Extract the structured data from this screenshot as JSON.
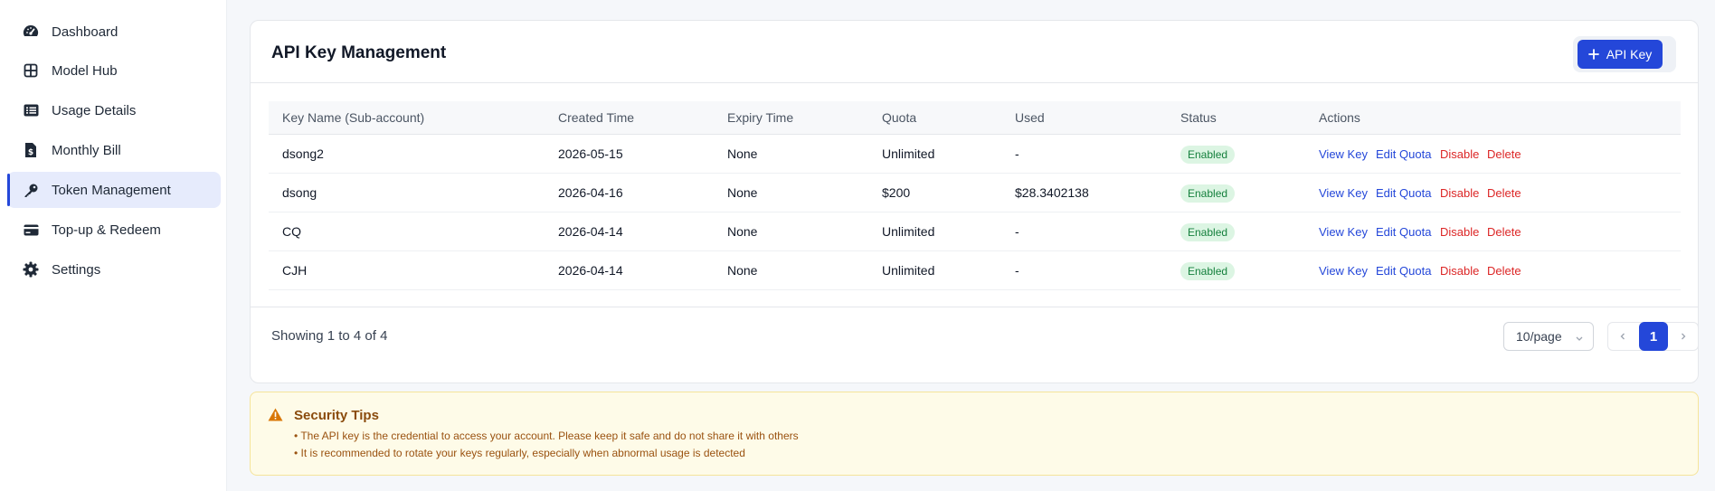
{
  "sidebar": {
    "items": [
      {
        "label": "Dashboard",
        "icon": "gauge-icon"
      },
      {
        "label": "Model Hub",
        "icon": "grid-icon"
      },
      {
        "label": "Usage Details",
        "icon": "list-icon"
      },
      {
        "label": "Monthly Bill",
        "icon": "receipt-icon"
      },
      {
        "label": "Token Management",
        "icon": "key-icon",
        "active": true
      },
      {
        "label": "Top-up & Redeem",
        "icon": "credit-card-icon"
      },
      {
        "label": "Settings",
        "icon": "gear-icon"
      }
    ]
  },
  "card": {
    "title": "API Key Management",
    "add_button_label": "API Key"
  },
  "table": {
    "headers": [
      "Key Name (Sub-account)",
      "Created Time",
      "Expiry Time",
      "Quota",
      "Used",
      "Status",
      "Actions"
    ],
    "rows": [
      {
        "name": "dsong2",
        "created": "2026-05-15",
        "expiry": "None",
        "quota": "Unlimited",
        "used": "-",
        "status": "Enabled"
      },
      {
        "name": "dsong",
        "created": "2026-04-16",
        "expiry": "None",
        "quota": "$200",
        "used": "$28.3402138",
        "status": "Enabled"
      },
      {
        "name": "CQ",
        "created": "2026-04-14",
        "expiry": "None",
        "quota": "Unlimited",
        "used": "-",
        "status": "Enabled"
      },
      {
        "name": "CJH",
        "created": "2026-04-14",
        "expiry": "None",
        "quota": "Unlimited",
        "used": "-",
        "status": "Enabled"
      }
    ],
    "actions": {
      "view": "View Key",
      "edit": "Edit Quota",
      "disable": "Disable",
      "delete": "Delete"
    }
  },
  "footer": {
    "showing": "Showing 1 to 4 of 4",
    "page_size": "10/page",
    "current_page": "1"
  },
  "tips": {
    "title": "Security Tips",
    "lines": [
      "• The API key is the credential to access your account. Please keep it safe and do not share it with others",
      "• It is recommended to rotate your keys regularly, especially when abnormal usage is detected"
    ]
  },
  "colors": {
    "accent": "#2447d9",
    "danger": "#dc2626",
    "success_bg": "#dcf5e3",
    "success_text": "#15803d",
    "warning_bg": "#fefbe8",
    "warning_text": "#8a4b0d"
  }
}
